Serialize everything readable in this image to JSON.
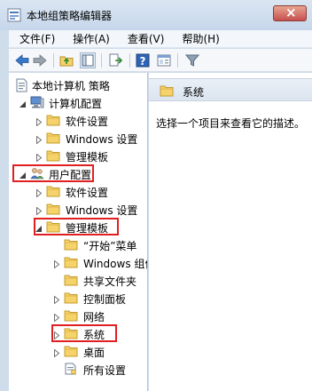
{
  "window": {
    "title": "本地组策略编辑器"
  },
  "menubar": {
    "items": [
      "文件(F)",
      "操作(A)",
      "查看(V)",
      "帮助(H)"
    ]
  },
  "toolbar": {
    "buttons": [
      "back-icon",
      "forward-icon",
      "up-folder-icon",
      "show-hide-tree-icon",
      "export-list-icon",
      "help-icon",
      "properties-icon",
      "filter-icon"
    ]
  },
  "tree": {
    "root": "本地计算机 策略",
    "computer_config": "计算机配置",
    "computer_software": "软件设置",
    "computer_windows": "Windows 设置",
    "computer_admin": "管理模板",
    "user_config": "用户配置",
    "user_software": "软件设置",
    "user_windows": "Windows 设置",
    "user_admin": "管理模板",
    "admin_start": "“开始”菜单",
    "admin_windows_components": "Windows 组件",
    "admin_shared_folders": "共享文件夹",
    "admin_control_panel": "控制面板",
    "admin_network": "网络",
    "admin_system": "系统",
    "admin_desktop": "桌面",
    "admin_all_settings": "所有设置"
  },
  "details": {
    "header": "系统",
    "description": "选择一个项目来查看它的描述。"
  },
  "colors": {
    "annotation_red": "#e02020",
    "folder_yellow": "#f5d36a",
    "window_frame": "#cfdcea"
  }
}
